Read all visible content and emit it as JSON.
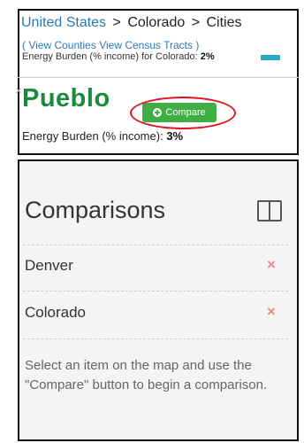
{
  "breadcrumb": {
    "country": "United States",
    "separator_1": ">",
    "state": "Colorado",
    "separator_2": ">",
    "level": "Cities"
  },
  "sublinks": {
    "open_paren": "(",
    "view_counties": "View Counties",
    "view_census_tracts": "View Census Tracts",
    "close_paren": ")"
  },
  "state_burden": {
    "label": "Energy Burden (% income) for Colorado:",
    "value": "2%",
    "bar_color": "#27a9c3"
  },
  "selection": {
    "close_label": "×",
    "city": "Pueblo",
    "compare_label": "Compare",
    "burden_label": "Energy Burden (% income):",
    "burden_value": "3%",
    "city_color": "#1c8a3c",
    "compare_color": "#3fae45",
    "highlight_color": "#e0141e"
  },
  "comparisons": {
    "title": "Comparisons",
    "layout_icon": "columns-icon",
    "items": [
      {
        "label": "Denver",
        "remove_label": "×"
      },
      {
        "label": "Colorado",
        "remove_label": "×"
      }
    ],
    "help_text": "Select an item on the map and use the \"Compare\" button to begin a comparison."
  }
}
